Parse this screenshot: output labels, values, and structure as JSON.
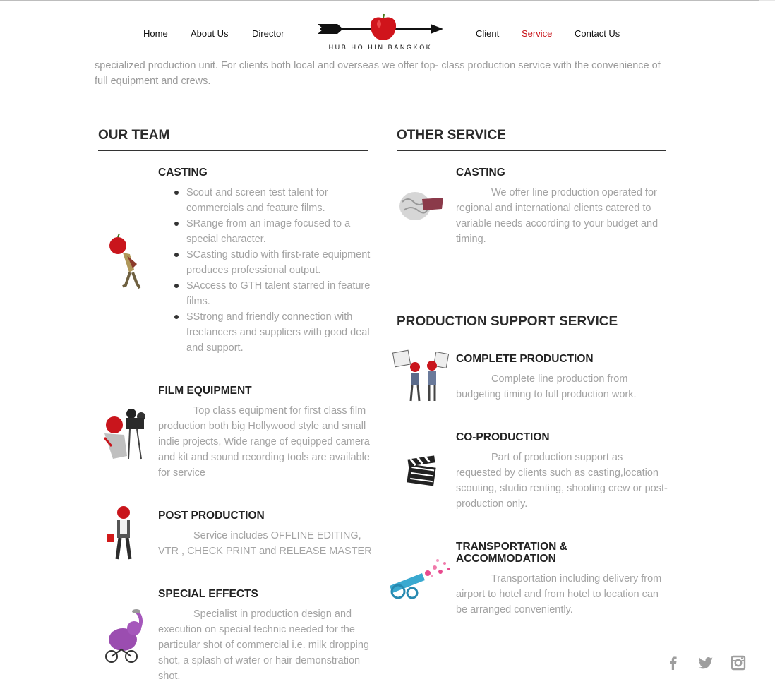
{
  "nav": {
    "left": [
      "Home",
      "About Us",
      "Director"
    ],
    "right": [
      "Client",
      "Service",
      "Contact Us"
    ],
    "active": "Service"
  },
  "logo": {
    "text": "HUB HO HIN BANGKOK"
  },
  "intro": "specialized production unit. For clients both local and overseas we offer top- class production service with the convenience of full equipment and crews.",
  "our_team": {
    "title": "OUR TEAM",
    "casting": {
      "title": "CASTING",
      "bullets": [
        "Scout and screen test talent for commercials and feature films.",
        "SRange from an image focused to a special character.",
        "SCasting studio with first-rate equipment produces professional output.",
        "SAccess to GTH talent starred in feature films.",
        "SStrong and friendly connection with freelancers and suppliers with good deal and support."
      ]
    },
    "film_equipment": {
      "title": "FILM EQUIPMENT",
      "text": "Top class equipment for first class film production both big Hollywood style and small indie projects, Wide range of equipped camera and kit and sound recording tools are available for service"
    },
    "post_production": {
      "title": "POST PRODUCTION",
      "text": "Service includes OFFLINE EDITING, VTR , CHECK PRINT and RELEASE MASTER"
    },
    "special_effects": {
      "title": "SPECIAL EFFECTS",
      "text": "Specialist in production design and execution on special technic needed for the particular shot of commercial i.e. milk dropping shot, a splash of water or hair demonstration shot."
    }
  },
  "other_service": {
    "title": "OTHER SERVICE",
    "casting": {
      "title": "CASTING",
      "text": "We offer line production operated for regional and international clients catered to variable needs according to your budget and timing."
    }
  },
  "production_support": {
    "title": "PRODUCTION SUPPORT SERVICE",
    "complete": {
      "title": "COMPLETE PRODUCTION",
      "text": "Complete line production from budgeting timing to full production work."
    },
    "co_production": {
      "title": "CO-PRODUCTION",
      "text": "Part of production support as requested by clients such as casting,location scouting, studio renting, shooting crew or post-production only."
    },
    "transport": {
      "title_line1": "TRANSPORTATION &",
      "title_line2": "ACCOMMODATION",
      "text": "Transportation including delivery from airport to hotel and from hotel to location can be arranged conveniently."
    }
  },
  "social": [
    "facebook-icon",
    "twitter-icon",
    "instagram-icon"
  ],
  "colors": {
    "accent": "#c8151b",
    "body_text": "#a3a3a3",
    "heading": "#2b2b2b",
    "social_icon": "#9e9e9e"
  }
}
